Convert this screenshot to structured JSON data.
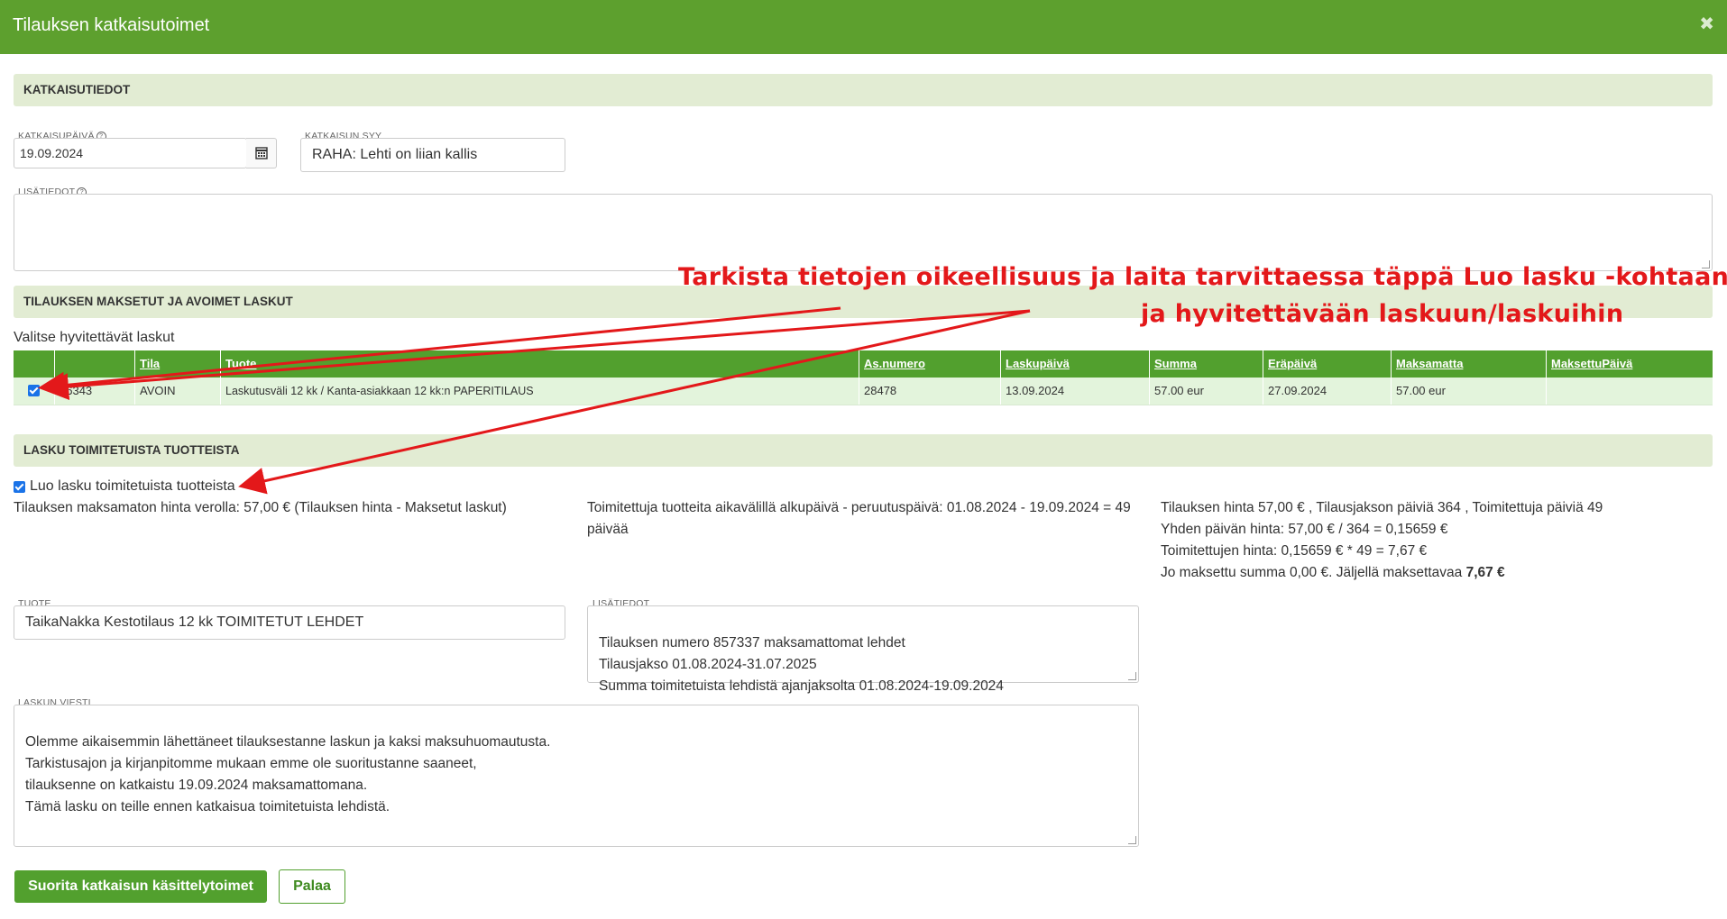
{
  "dialog": {
    "title": "Tilauksen katkaisutoimet",
    "close_glyph": "✖"
  },
  "sections": {
    "katkaisutiedot": "KATKAISUTIEDOT",
    "laskut": "TILAUKSEN MAKSETUT JA AVOIMET LASKUT",
    "lasku_toimitetuista": "LASKU TOIMITETUISTA TUOTTEISTA"
  },
  "cancel": {
    "date_label": "KATKAISUPÄIVÄ",
    "date_value": "19.09.2024",
    "reason_label": "KATKAISUN SYY",
    "reason_value": "RAHA: Lehti on liian kallis",
    "extra_label": "LISÄTIEDOT",
    "extra_value": ""
  },
  "invoices": {
    "instruction": "Valitse hyvitettävät laskut",
    "columns": [
      "Tila",
      "Tuote",
      "As.numero",
      "Laskupäivä",
      "Summa",
      "Eräpäivä",
      "Maksamatta",
      "MaksettuPäivä"
    ],
    "row": {
      "checked": true,
      "id": "16343",
      "tila": "AVOIN",
      "tuote": "Laskutusväli 12 kk / Kanta-asiakkaan 12 kk:n PAPERITILAUS",
      "as_numero": "28478",
      "laskupaiva": "13.09.2024",
      "summa": "57.00 eur",
      "erapaiva": "27.09.2024",
      "maksamatta": "57.00 eur",
      "maksettu_paiva": ""
    }
  },
  "delivered": {
    "checkbox_label": "Luo lasku toimitetuista tuotteista",
    "checked": true,
    "unpaid_text": "Tilauksen maksamaton hinta verolla: 57,00 € (Tilauksen hinta - Maksetut laskut)",
    "period_text": "Toimitettuja tuotteita aikavälillä alkupäivä - peruutuspäivä: 01.08.2024 - 19.09.2024 = 49 päivää",
    "calc_lines": [
      "Tilauksen hinta 57,00 € , Tilausjakson päiviä 364 , Toimitettuja päiviä 49",
      "Yhden päivän hinta: 57,00 € / 364 = 0,15659 €",
      "Toimitettujen hinta: 0,15659 € * 49 = 7,67 €"
    ],
    "calc_last_prefix": "Jo maksettu summa 0,00 €. Jäljellä maksettavaa",
    "calc_last_amount": "7,67 €",
    "product_label": "TUOTE",
    "product_value": "TaikaNakka Kestotilaus 12 kk TOIMITETUT LEHDET",
    "info_label": "LISÄTIEDOT",
    "info_value": "Tilauksen numero 857337 maksamattomat lehdet\nTilausjakso 01.08.2024-31.07.2025\nSumma toimitetuista lehdistä ajanjaksolta 01.08.2024-19.09.2024",
    "message_label": "LASKUN VIESTI",
    "message_value": "Olemme aikaisemmin lähettäneet tilauksestanne laskun ja kaksi maksuhuomautusta.\nTarkistusajon ja kirjanpitomme mukaan emme ole suoritustanne saaneet,\ntilauksenne on katkaistu 19.09.2024 maksamattomana.\nTämä lasku on teille ennen katkaisua toimitetuista lehdistä."
  },
  "buttons": {
    "submit": "Suorita katkaisun käsittelytoimet",
    "back": "Palaa"
  },
  "annotation": {
    "line1": "Tarkista tietojen oikeellisuus ja laita tarvittaessa täppä Luo lasku -kohtaan",
    "line2": "ja hyvitettävään laskuun/laskuihin",
    "color": "#e3181a"
  },
  "colors": {
    "brand_green": "#5da02e",
    "section_bg": "#e2ecd3",
    "row_bg": "#e3f4dc"
  }
}
